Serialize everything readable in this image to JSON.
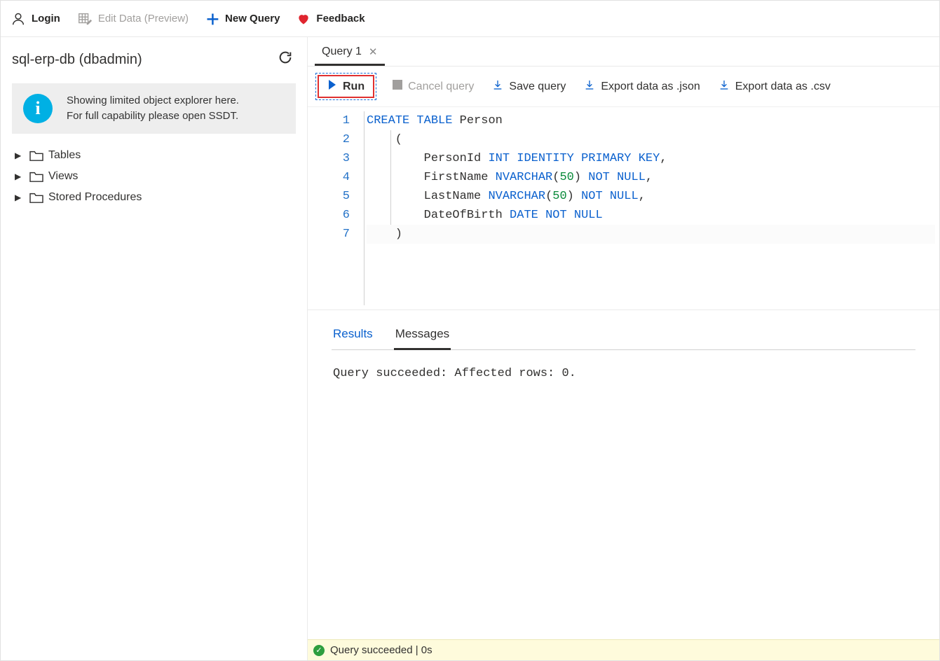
{
  "toolbar": {
    "login": "Login",
    "edit_data": "Edit Data (Preview)",
    "new_query": "New Query",
    "feedback": "Feedback"
  },
  "sidebar": {
    "title": "sql-erp-db (dbadmin)",
    "info_line1": "Showing limited object explorer here.",
    "info_line2": "For full capability please open SSDT.",
    "tree": [
      {
        "label": "Tables"
      },
      {
        "label": "Views"
      },
      {
        "label": "Stored Procedures"
      }
    ]
  },
  "tabs": {
    "active": "Query 1"
  },
  "query_toolbar": {
    "run": "Run",
    "cancel": "Cancel query",
    "save": "Save query",
    "export_json": "Export data as .json",
    "export_csv": "Export data as .csv"
  },
  "editor": {
    "lines": [
      {
        "n": 1,
        "tokens": [
          {
            "t": "CREATE",
            "c": "kw"
          },
          {
            "t": " "
          },
          {
            "t": "TABLE",
            "c": "kw"
          },
          {
            "t": " Person"
          }
        ]
      },
      {
        "n": 2,
        "tokens": [
          {
            "t": "    ("
          }
        ]
      },
      {
        "n": 3,
        "tokens": [
          {
            "t": "        PersonId "
          },
          {
            "t": "INT",
            "c": "kw"
          },
          {
            "t": " "
          },
          {
            "t": "IDENTITY",
            "c": "kw"
          },
          {
            "t": " "
          },
          {
            "t": "PRIMARY",
            "c": "kw"
          },
          {
            "t": " "
          },
          {
            "t": "KEY",
            "c": "kw"
          },
          {
            "t": ","
          }
        ]
      },
      {
        "n": 4,
        "tokens": [
          {
            "t": "        FirstName "
          },
          {
            "t": "NVARCHAR",
            "c": "kw"
          },
          {
            "t": "("
          },
          {
            "t": "50",
            "c": "num"
          },
          {
            "t": ") "
          },
          {
            "t": "NOT",
            "c": "kw"
          },
          {
            "t": " "
          },
          {
            "t": "NULL",
            "c": "kw"
          },
          {
            "t": ","
          }
        ]
      },
      {
        "n": 5,
        "tokens": [
          {
            "t": "        LastName "
          },
          {
            "t": "NVARCHAR",
            "c": "kw"
          },
          {
            "t": "("
          },
          {
            "t": "50",
            "c": "num"
          },
          {
            "t": ") "
          },
          {
            "t": "NOT",
            "c": "kw"
          },
          {
            "t": " "
          },
          {
            "t": "NULL",
            "c": "kw"
          },
          {
            "t": ","
          }
        ]
      },
      {
        "n": 6,
        "tokens": [
          {
            "t": "        DateOfBirth "
          },
          {
            "t": "DATE",
            "c": "kw"
          },
          {
            "t": " "
          },
          {
            "t": "NOT",
            "c": "kw"
          },
          {
            "t": " "
          },
          {
            "t": "NULL",
            "c": "kw"
          }
        ]
      },
      {
        "n": 7,
        "tokens": [
          {
            "t": "    )"
          }
        ],
        "hl": true
      }
    ]
  },
  "results_panel": {
    "tab_results": "Results",
    "tab_messages": "Messages",
    "message": "Query succeeded: Affected rows: 0."
  },
  "status": {
    "text": "Query succeeded | 0s"
  }
}
